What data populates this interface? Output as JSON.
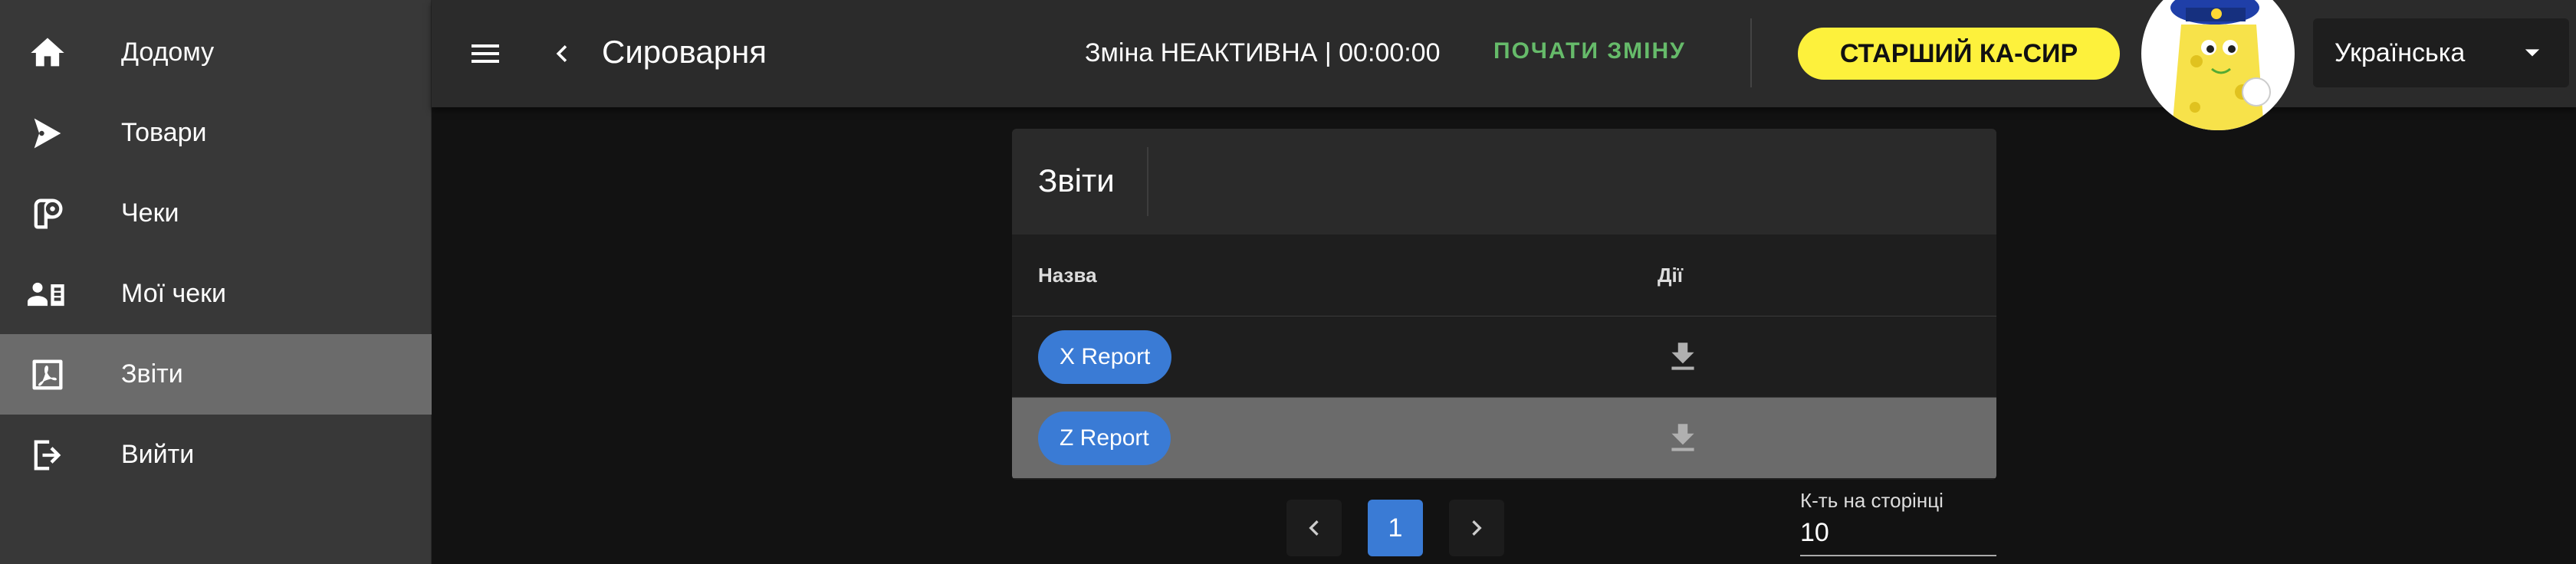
{
  "sidebar": {
    "items": [
      {
        "label": "Додому",
        "icon": "home-icon",
        "active": false
      },
      {
        "label": "Товари",
        "icon": "goods-icon",
        "active": false
      },
      {
        "label": "Чеки",
        "icon": "receipt-roll-icon",
        "active": false
      },
      {
        "label": "Мої чеки",
        "icon": "user-receipt-icon",
        "active": false
      },
      {
        "label": "Звіти",
        "icon": "report-pdf-icon",
        "active": true
      },
      {
        "label": "Вийти",
        "icon": "logout-icon",
        "active": false
      }
    ]
  },
  "header": {
    "menu_icon": "hamburger-menu-icon",
    "back_icon": "chevron-left-icon",
    "title": "Сироварня",
    "shift_status": "Зміна НЕАКТИВНА | 00:00:00",
    "start_shift_label": "ПОЧАТИ ЗМІНУ",
    "role_badge": "СТАРШИЙ КА-СИР",
    "role_badge_color": "#fdf13c",
    "language": "Українська"
  },
  "reports": {
    "title": "Звіти",
    "columns": {
      "name": "Назва",
      "actions": "Дії"
    },
    "rows": [
      {
        "name": "X Report",
        "action_icon": "download-icon"
      },
      {
        "name": "Z Report",
        "action_icon": "download-icon"
      }
    ]
  },
  "pagination": {
    "current_page": "1",
    "per_page_label": "К-ть на сторінці",
    "per_page_value": "10"
  },
  "colors": {
    "accent": "#3a7bd5",
    "start_shift": "#66bb6a",
    "background": "#121212"
  }
}
